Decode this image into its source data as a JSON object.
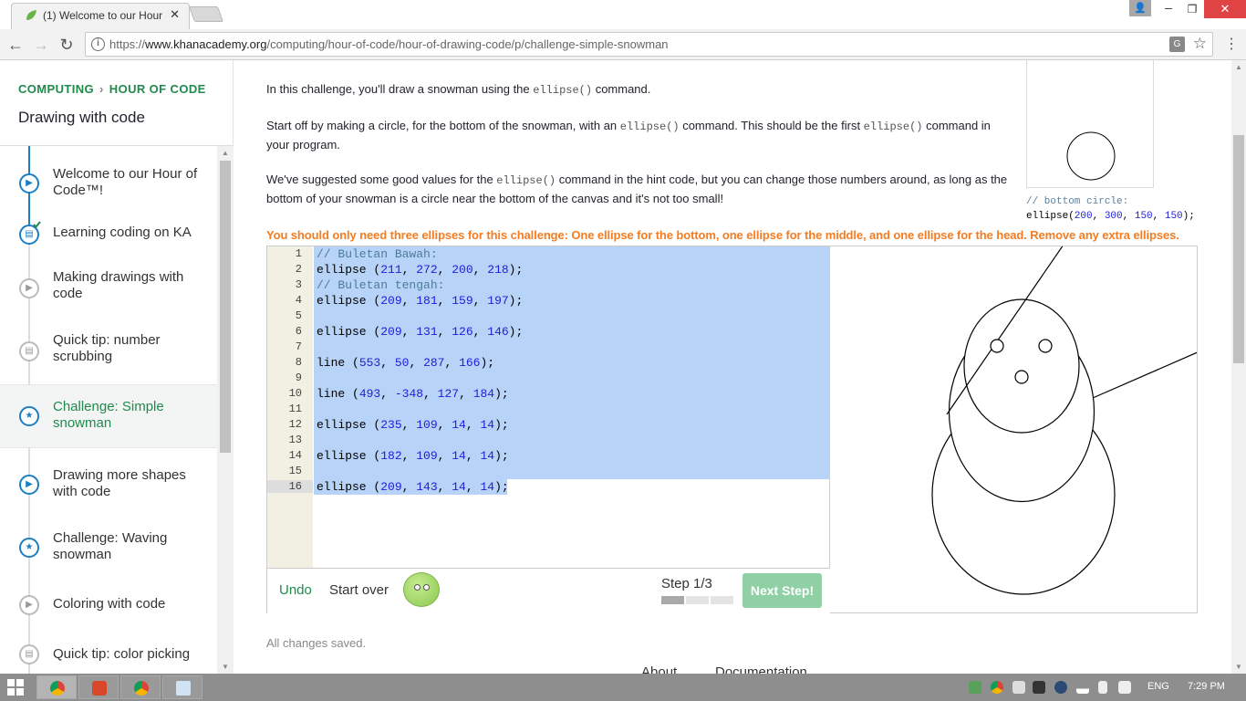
{
  "browser": {
    "tab_title": "(1) Welcome to our Hour",
    "url_scheme": "https://",
    "url_host": "www.khanacademy.org",
    "url_path": "/computing/hour-of-code/hour-of-drawing-code/p/challenge-simple-snowman"
  },
  "sidebar": {
    "crumb_1": "COMPUTING",
    "crumb_sep": "›",
    "crumb_2": "HOUR OF CODE",
    "title": "Drawing with code",
    "items": [
      {
        "label": "Welcome to our Hour of Code™!",
        "icon": "play-icon",
        "status": "current"
      },
      {
        "label": "Learning coding on KA",
        "icon": "article-icon",
        "status": "completed"
      },
      {
        "label": "Making drawings with code",
        "icon": "play-icon",
        "status": "not-started"
      },
      {
        "label": "Quick tip: number scrubbing",
        "icon": "article-icon",
        "status": "not-started"
      },
      {
        "label": "Challenge: Simple snowman",
        "icon": "star-icon",
        "status": "active"
      },
      {
        "label": "Drawing more shapes with code",
        "icon": "play-icon",
        "status": "current"
      },
      {
        "label": "Challenge: Waving snowman",
        "icon": "star-icon",
        "status": "current"
      },
      {
        "label": "Coloring with code",
        "icon": "play-icon",
        "status": "not-started"
      },
      {
        "label": "Quick tip: color picking",
        "icon": "article-icon",
        "status": "not-started"
      }
    ]
  },
  "instructions": {
    "p1_a": "In this challenge, you'll draw a snowman using the ",
    "p1_code": "ellipse()",
    "p1_b": " command.",
    "p2_a": "Start off by making a circle, for the bottom of the snowman, with an ",
    "p2_code1": "ellipse()",
    "p2_b": " command. This should be the first ",
    "p2_code2": "ellipse()",
    "p2_c": " command in your program.",
    "p3_a": "We've suggested some good values for the ",
    "p3_code": "ellipse()",
    "p3_b": " command in the hint code, but you can change those numbers around, as long as the bottom of your snowman is a circle near the bottom of the canvas and it's not too small!",
    "warning": "You should only need three ellipses for this challenge: One ellipse for the bottom, one ellipse for the middle, and one ellipse for the head. Remove any extra ellipses."
  },
  "hint": {
    "comment": "// bottom circle:",
    "call": "ellipse(",
    "args": [
      "200",
      "300",
      "150",
      "150"
    ],
    "close": ");"
  },
  "code_lines": [
    {
      "num": "1",
      "comment": "// Buletan Bawah:"
    },
    {
      "num": "2",
      "fn": "ellipse",
      "args": [
        "211",
        "272",
        "200",
        "218"
      ]
    },
    {
      "num": "3",
      "comment": "// Buletan tengah:"
    },
    {
      "num": "4",
      "fn": "ellipse",
      "args": [
        "209",
        "181",
        "159",
        "197"
      ]
    },
    {
      "num": "5"
    },
    {
      "num": "6",
      "fn": "ellipse",
      "args": [
        "209",
        "131",
        "126",
        "146"
      ]
    },
    {
      "num": "7"
    },
    {
      "num": "8",
      "fn": "line",
      "args": [
        "553",
        "50",
        "287",
        "166"
      ]
    },
    {
      "num": "9"
    },
    {
      "num": "10",
      "fn": "line",
      "args": [
        "493",
        "-348",
        "127",
        "184"
      ]
    },
    {
      "num": "11"
    },
    {
      "num": "12",
      "fn": "ellipse",
      "args": [
        "235",
        "109",
        "14",
        "14"
      ]
    },
    {
      "num": "13"
    },
    {
      "num": "14",
      "fn": "ellipse",
      "args": [
        "182",
        "109",
        "14",
        "14"
      ]
    },
    {
      "num": "15"
    },
    {
      "num": "16",
      "fn": "ellipse",
      "args": [
        "209",
        "143",
        "14",
        "14"
      ]
    }
  ],
  "controls": {
    "undo": "Undo",
    "start_over": "Start over",
    "step": "Step 1/3",
    "step_progress": 0.3333,
    "next_step": "Next Step!"
  },
  "status": "All changes saved.",
  "bottom_tabs": {
    "about": "About",
    "docs": "Documentation"
  },
  "taskbar": {
    "lang": "ENG",
    "time": "7:29 PM"
  },
  "colors": {
    "brand_green": "#1f8a4c",
    "warning_orange": "#f57c20",
    "selection_blue": "#b7d3f7",
    "link_blue": "#1c7fc4"
  }
}
